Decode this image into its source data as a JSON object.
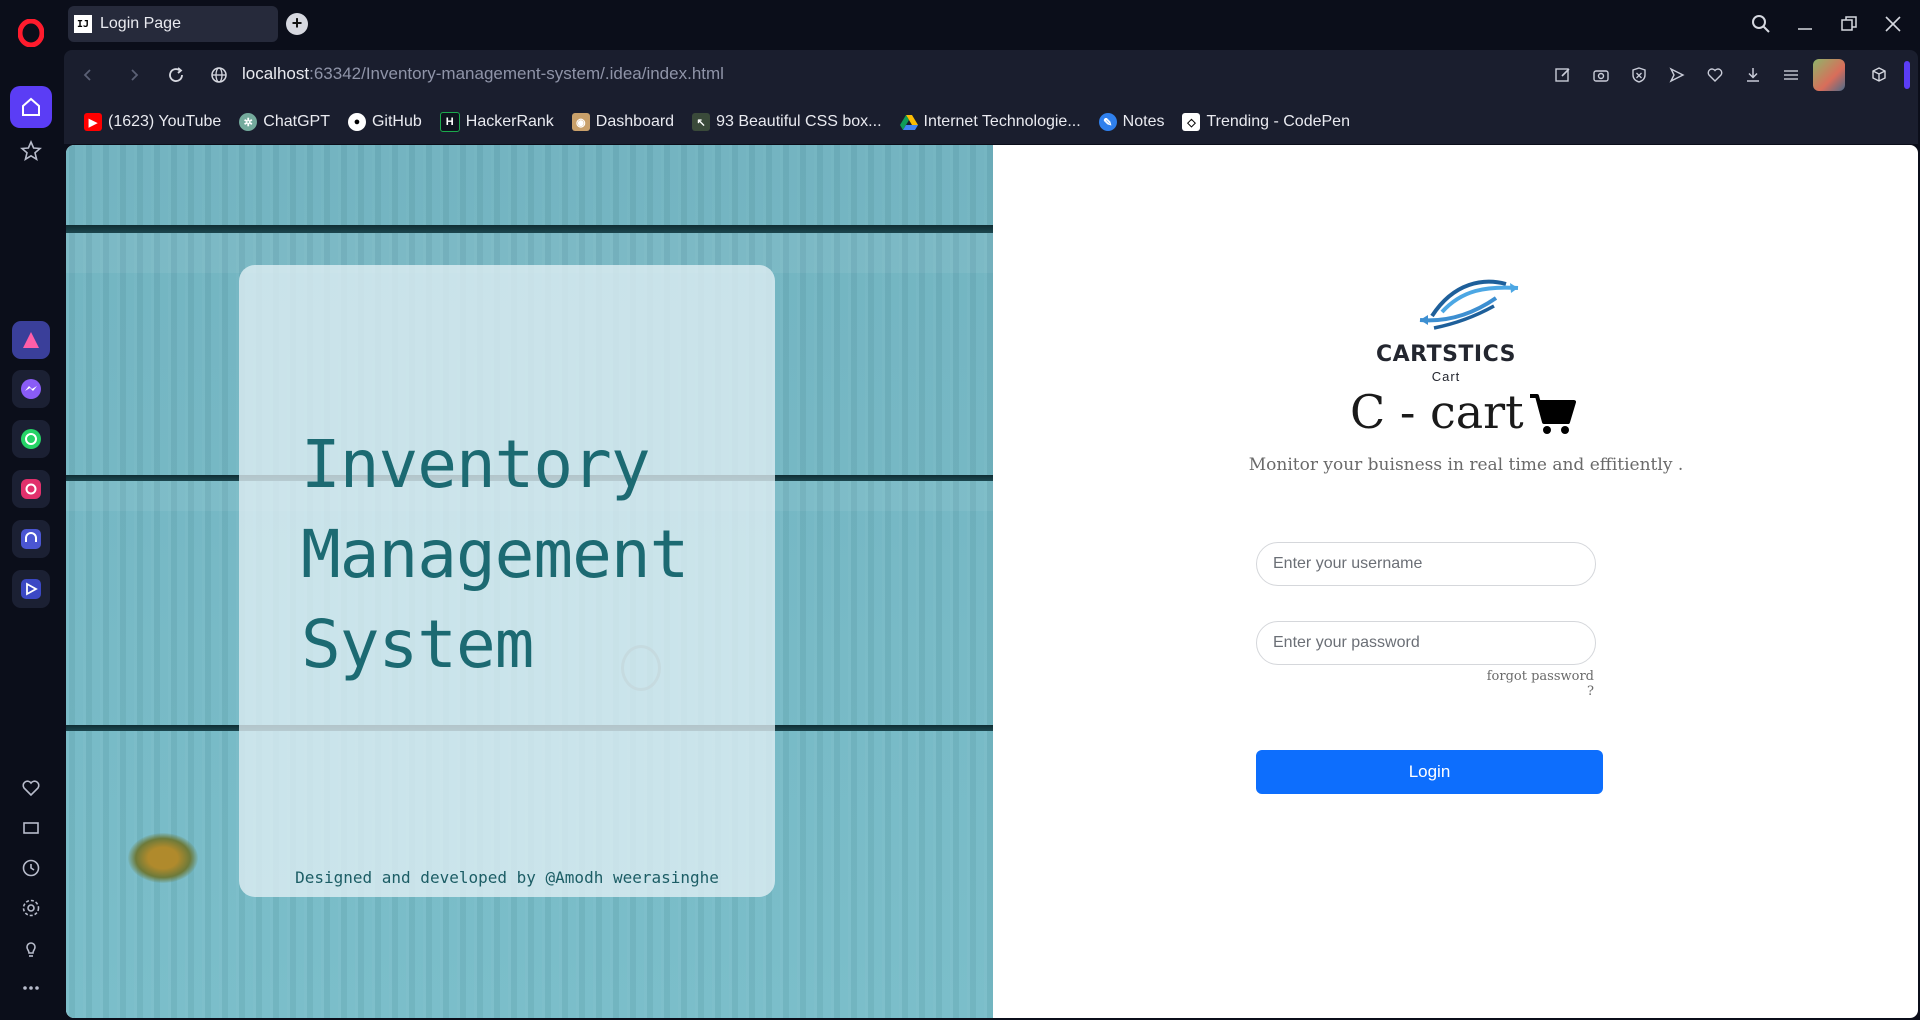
{
  "browser": {
    "tab_title": "Login Page",
    "tab_favicon_text": "IJ",
    "url_host": "localhost",
    "url_rest": ":63342/Inventory-management-system/.idea/index.html"
  },
  "bookmarks": [
    {
      "label": "(1623) YouTube",
      "icon": "youtube-icon",
      "color": "#ff0000"
    },
    {
      "label": "ChatGPT",
      "icon": "chatgpt-icon",
      "color": "#74aa9c"
    },
    {
      "label": "GitHub",
      "icon": "github-icon",
      "color": "#ffffff"
    },
    {
      "label": "HackerRank",
      "icon": "hackerrank-icon",
      "color": "#1ba94c"
    },
    {
      "label": "Dashboard",
      "icon": "dashboard-icon",
      "color": "#c9a06a"
    },
    {
      "label": "93 Beautiful CSS box...",
      "icon": "css-box-icon",
      "color": "#6b8e6b"
    },
    {
      "label": "Internet Technologie...",
      "icon": "google-drive-icon",
      "color": "#fbbc04"
    },
    {
      "label": "Notes",
      "icon": "notes-icon",
      "color": "#2f80ed"
    },
    {
      "label": "Trending - CodePen",
      "icon": "codepen-icon",
      "color": "#ffffff"
    }
  ],
  "left_panel": {
    "title_line1": "Inventory",
    "title_line2": "Management",
    "title_line3": "System",
    "credit": "Designed and developed by @Amodh weerasinghe"
  },
  "brand": {
    "name": "CARTSTICS",
    "sub": "Cart"
  },
  "login": {
    "app_title": "C - cart",
    "tagline": "Monitor your buisness in real time and effitiently .",
    "username_placeholder": "Enter your username",
    "password_placeholder": "Enter your password",
    "forgot_label": "forgot password ?",
    "login_label": "Login"
  },
  "colors": {
    "accent_button": "#0d6efd",
    "wood": "#6fb2bf",
    "title_text": "#1c6a72"
  }
}
